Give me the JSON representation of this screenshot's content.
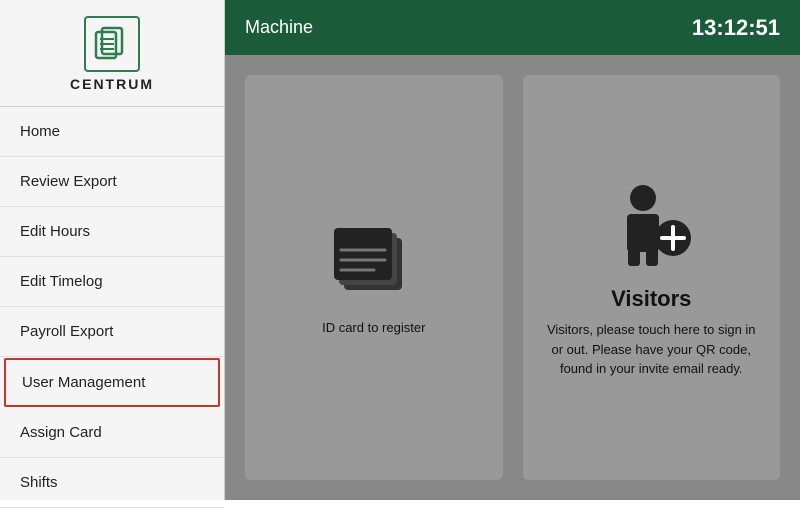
{
  "header": {
    "title": "Machine",
    "time": "13:12:51"
  },
  "logo": {
    "text": "CENTRUM"
  },
  "nav": {
    "items": [
      {
        "id": "home",
        "label": "Home",
        "active": false
      },
      {
        "id": "review-export",
        "label": "Review Export",
        "active": false
      },
      {
        "id": "edit-hours",
        "label": "Edit Hours",
        "active": false
      },
      {
        "id": "edit-timelog",
        "label": "Edit Timelog",
        "active": false
      },
      {
        "id": "payroll-export",
        "label": "Payroll Export",
        "active": false
      },
      {
        "id": "user-management",
        "label": "User Management",
        "active": true
      },
      {
        "id": "assign-card",
        "label": "Assign Card",
        "active": false
      },
      {
        "id": "shifts",
        "label": "Shifts",
        "active": false
      }
    ]
  },
  "cards": [
    {
      "id": "id-card",
      "title": "",
      "description": "ID card to register",
      "icon": "id-card"
    },
    {
      "id": "visitors",
      "title": "Visitors",
      "description": "Visitors, please touch here to sign in or out. Please have your QR code, found in your invite email ready.",
      "icon": "visitor"
    }
  ]
}
